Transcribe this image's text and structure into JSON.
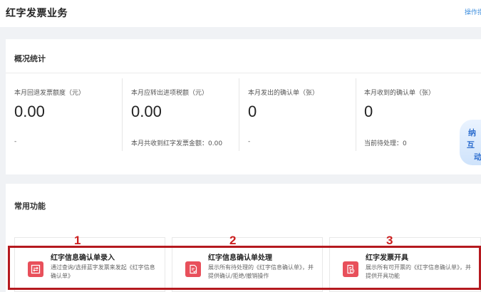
{
  "header": {
    "title": "红字发票业务",
    "guide_link": "操作指"
  },
  "stats_section": {
    "title": "概况统计",
    "items": [
      {
        "label": "本月回退发票额度（元）",
        "value": "0.00",
        "footer": "-"
      },
      {
        "label": "本月应转出进项税额（元）",
        "value": "0.00",
        "footer": "本月共收到红字发票金额：0.00"
      },
      {
        "label": "本月发出的确认单（张）",
        "value": "0",
        "footer": "-"
      },
      {
        "label": "本月收到的确认单（张）",
        "value": "0",
        "footer": "当前待处理：0"
      }
    ]
  },
  "floating_widget": {
    "line1": "纳",
    "line2": "互",
    "line3": "动"
  },
  "functions_section": {
    "title": "常用功能",
    "items": [
      {
        "number": "1",
        "title": "红字信息确认单录入",
        "desc": "通过查询/选择蓝字发票来发起《红字信息确认单》",
        "icon": "document-exchange-icon"
      },
      {
        "number": "2",
        "title": "红字信息确认单处理",
        "desc": "展示所有待处理的《红字信息确认单》，并提供确认/拒绝/撤销操作",
        "icon": "document-check-icon"
      },
      {
        "number": "3",
        "title": "红字发票开具",
        "desc": "展示所有可开票的《红字信息确认单》，并提供开具功能",
        "icon": "invoice-clock-icon"
      }
    ]
  },
  "colors": {
    "accent_red": "#e8505b",
    "annotation_red": "#b5191f",
    "link_blue": "#3c8dde"
  }
}
